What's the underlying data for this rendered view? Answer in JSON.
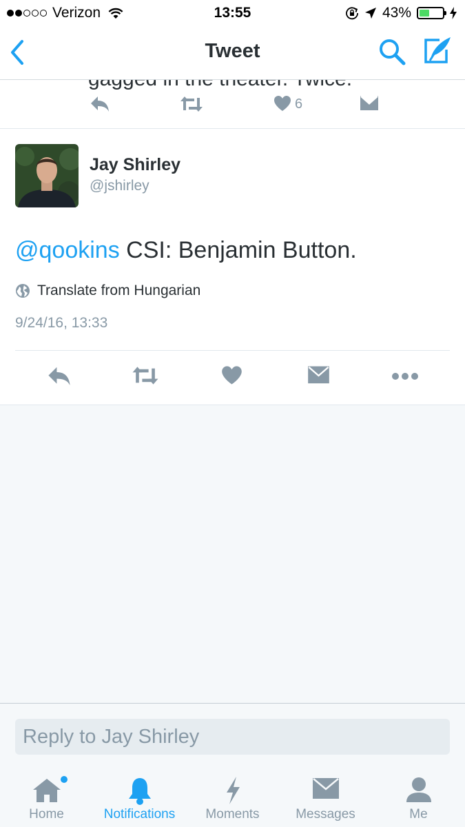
{
  "status_bar": {
    "carrier": "Verizon",
    "time": "13:55",
    "battery_percent": "43%",
    "battery_level": 0.43,
    "icons": [
      "wifi-icon",
      "rotation-lock-icon",
      "location-arrow-icon",
      "charging-bolt-icon"
    ]
  },
  "nav": {
    "title": "Tweet",
    "back_icon": "chevron-left-icon",
    "search_icon": "search-icon",
    "compose_icon": "compose-tweet-icon"
  },
  "previous_tweet": {
    "text_fragment": "gagged in the theater. Twice.",
    "like_count": "6"
  },
  "tweet": {
    "author_name": "Jay Shirley",
    "author_handle": "@jshirley",
    "mention": "@qookins",
    "body": " CSI: Benjamin Button.",
    "translate_label": "Translate from Hungarian",
    "timestamp": "9/24/16, 13:33"
  },
  "reply": {
    "placeholder": "Reply to Jay Shirley"
  },
  "tabs": [
    {
      "label": "Home",
      "icon": "home-icon",
      "has_badge": true
    },
    {
      "label": "Notifications",
      "icon": "bell-icon",
      "active": true
    },
    {
      "label": "Moments",
      "icon": "lightning-icon"
    },
    {
      "label": "Messages",
      "icon": "envelope-icon"
    },
    {
      "label": "Me",
      "icon": "person-icon"
    }
  ],
  "colors": {
    "accent": "#1da1f2",
    "icon_gray": "#8899a6",
    "text": "#292f33",
    "background": "#f5f8fa",
    "battery_green": "#4cd964"
  }
}
